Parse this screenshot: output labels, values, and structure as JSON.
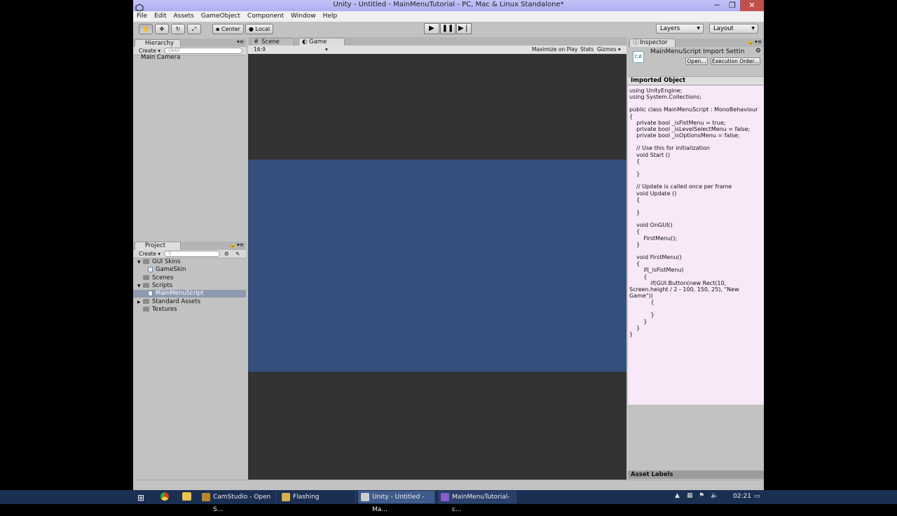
{
  "window": {
    "title": "Unity - Untitled - MainMenuTutorial - PC, Mac & Linux Standalone*"
  },
  "menu": [
    "File",
    "Edit",
    "Assets",
    "GameObject",
    "Component",
    "Window",
    "Help"
  ],
  "toolbar": {
    "center": "Center",
    "local": "Local",
    "layers": "Layers",
    "layout": "Layout"
  },
  "hierarchy": {
    "tab": "Hierarchy",
    "create": "Create",
    "search_placeholder": "Q▾All",
    "items": [
      "Main Camera"
    ]
  },
  "scene_tab": "Scene",
  "game": {
    "tab": "Game",
    "aspect": "16:9",
    "maximize": "Maximize on Play",
    "stats": "Stats",
    "gizmos": "Gizmos"
  },
  "project": {
    "tab": "Project",
    "create": "Create",
    "items": [
      {
        "label": "GUI Skins",
        "level": 0,
        "expanded": true
      },
      {
        "label": "GameSkin",
        "level": 1,
        "file": true
      },
      {
        "label": "Scenes",
        "level": 0
      },
      {
        "label": "Scripts",
        "level": 0,
        "expanded": true
      },
      {
        "label": "MainMenuScript",
        "level": 1,
        "file": true,
        "selected": true
      },
      {
        "label": "Standard Assets",
        "level": 0,
        "collapsed": true
      },
      {
        "label": "Textures",
        "level": 0
      }
    ]
  },
  "inspector": {
    "tab": "Inspector",
    "title": "MainMenuScript Import Settin",
    "open": "Open...",
    "exec": "Execution Order...",
    "section": "Imported Object",
    "asset_labels": "Asset Labels",
    "code": "using UnityEngine;\nusing System.Collections;\n\npublic class MainMenuScript : MonoBehaviour\n{\n    private bool _isFistMenu = true;\n    private bool _isLevelSelectMenu = false;\n    private bool _isOptionsMenu = false;\n\n    // Use this for initialization\n    void Start ()\n    {\n\n    }\n\n    // Update is called once per frame\n    void Update ()\n    {\n\n    }\n\n    void OnGUI()\n    {\n        FirstMenu();\n    }\n\n    void FirstMenu()\n    {\n        if(_isFistMenu)\n        {\n            if(GUI.Button(new Rect(10,\nScreen.height / 2 - 100, 150, 25), \"New\nGame\"))\n            {\n\n            }\n        }\n    }\n}"
  },
  "taskbar": {
    "items": [
      "CamStudio - Open S...",
      "Flashing",
      "Unity - Untitled - Ma...",
      "MainMenuTutorial-c..."
    ],
    "clock": "02:21"
  },
  "colors": {
    "game_bg": "#333333",
    "game_blue": "#354f7c",
    "taskbar": "#1b2f52",
    "code_bg": "#f8e8f8"
  }
}
